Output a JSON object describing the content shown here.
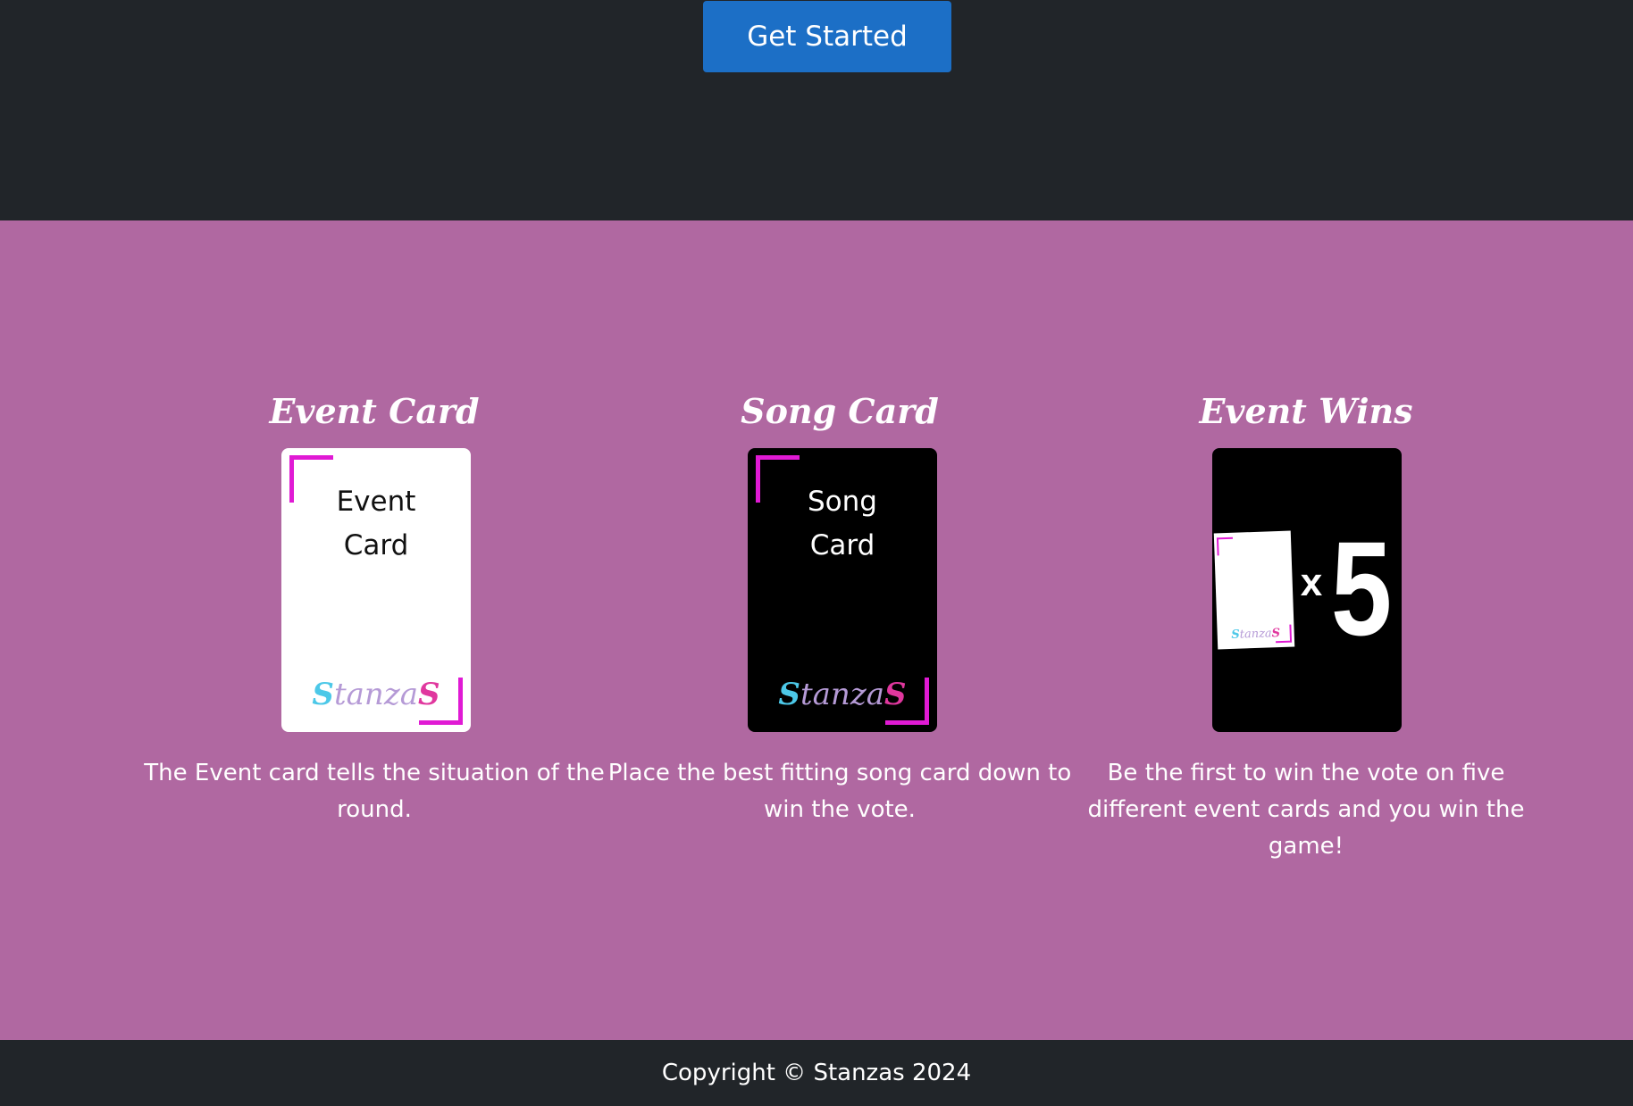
{
  "hero": {
    "cta_label": "Get Started"
  },
  "features": [
    {
      "title": "Event Card",
      "card_text_line1": "Event",
      "card_text_line2": "Card",
      "card_style": "white",
      "description": "The Event card tells the situation of the round."
    },
    {
      "title": "Song Card",
      "card_text_line1": "Song",
      "card_text_line2": "Card",
      "card_style": "black",
      "description": "Place the best fitting song card down to win the vote."
    },
    {
      "title": "Event Wins",
      "multiplier_sign": "x",
      "multiplier_value": "5",
      "card_style": "black",
      "description": "Be the first to win the vote on five different event cards and you win the game!"
    }
  ],
  "brand_logo": {
    "part1": "S",
    "part2": "tanza",
    "part3": "S"
  },
  "footer": {
    "copyright": "Copyright © Stanzas 2024"
  },
  "colors": {
    "dark_bg": "#212529",
    "section_bg": "#b068a1",
    "cta_blue": "#1c6fc6",
    "accent_magenta": "#e01ad4",
    "logo_cyan": "#4cc8e8",
    "logo_pink": "#e0379e"
  }
}
